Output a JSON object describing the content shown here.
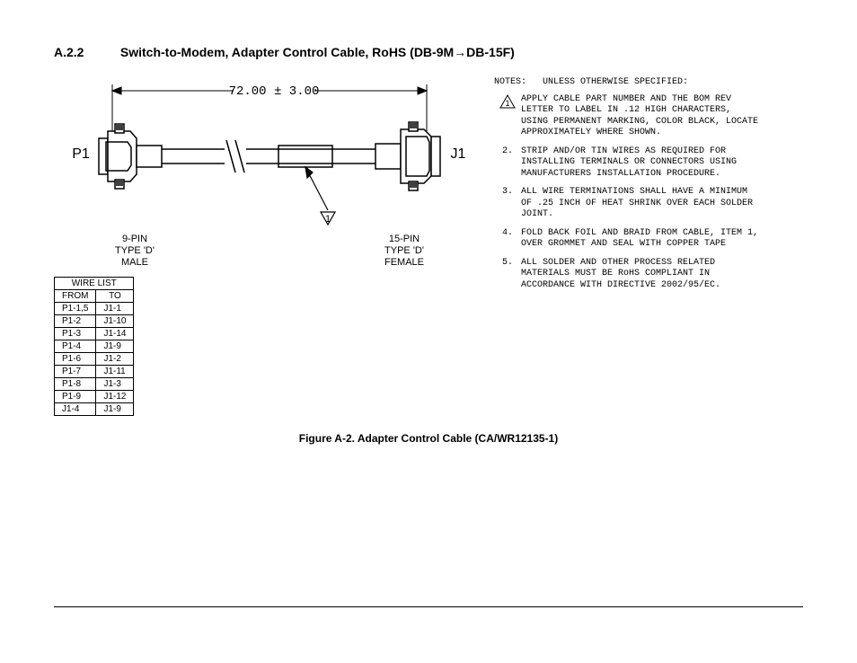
{
  "heading_number": "A.2.2",
  "heading_text": "Switch-to-Modem, Adapter Control Cable, RoHS (DB-9M→DB-15F)",
  "cable_length": "72.00  ±  3.00",
  "left_conn_label": "P1",
  "right_conn_label": "J1",
  "left_conn_desc1": "9-PIN",
  "left_conn_desc2": "TYPE 'D'",
  "left_conn_desc3": "MALE",
  "right_conn_desc1": "15-PIN",
  "right_conn_desc2": "TYPE 'D'",
  "right_conn_desc3": "FEMALE",
  "callout_triangle": "1",
  "wire_list_title": "WIRE  LIST",
  "wire_list_from": "FROM",
  "wire_list_to": "TO",
  "wire_list": [
    {
      "from": "P1-1,5",
      "to": "J1-1"
    },
    {
      "from": "P1-2",
      "to": "J1-10"
    },
    {
      "from": "P1-3",
      "to": "J1-14"
    },
    {
      "from": "P1-4",
      "to": "J1-9"
    },
    {
      "from": "P1-6",
      "to": "J1-2"
    },
    {
      "from": "P1-7",
      "to": "J1-11"
    },
    {
      "from": "P1-8",
      "to": "J1-3"
    },
    {
      "from": "P1-9",
      "to": "J1-12"
    },
    {
      "from": "J1-4",
      "to": "J1-9"
    }
  ],
  "notes_label": "NOTES:",
  "notes_subhead": "UNLESS OTHERWISE SPECIFIED:",
  "notes": [
    {
      "marker": "tri",
      "num": "1",
      "text": "APPLY CABLE PART NUMBER AND THE BOM REV LETTER TO LABEL IN .12 HIGH CHARACTERS, USING PERMANENT MARKING, COLOR BLACK, LOCATE APPROXIMATELY WHERE SHOWN."
    },
    {
      "marker": "num",
      "num": "2.",
      "text": "STRIP AND/OR TIN WIRES AS REQUIRED FOR INSTALLING TERMINALS OR CONNECTORS USING MANUFACTURERS INSTALLATION PROCEDURE."
    },
    {
      "marker": "num",
      "num": "3.",
      "text": "ALL WIRE TERMINATIONS SHALL HAVE A MINIMUM OF .25 INCH OF HEAT SHRINK OVER EACH SOLDER JOINT."
    },
    {
      "marker": "num",
      "num": "4.",
      "text": "FOLD BACK FOIL AND BRAID FROM CABLE, ITEM 1, OVER GROMMET AND SEAL WITH COPPER TAPE"
    },
    {
      "marker": "num",
      "num": "5.",
      "text": "ALL SOLDER AND OTHER PROCESS RELATED MATERIALS MUST BE RoHS COMPLIANT IN ACCORDANCE WITH DIRECTIVE 2002/95/EC."
    }
  ],
  "figure_caption": "Figure A-2. Adapter Control Cable (CA/WR12135-1)"
}
